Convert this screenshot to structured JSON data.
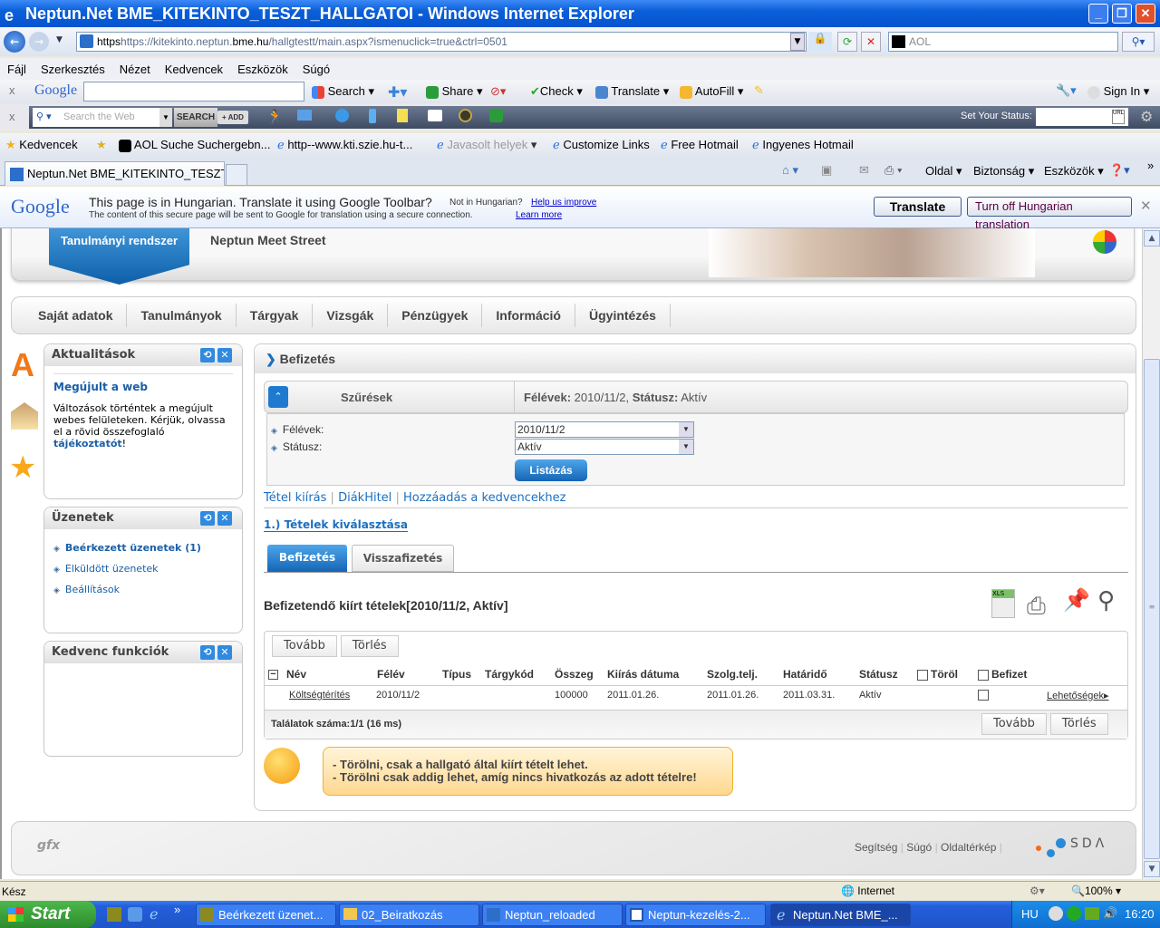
{
  "window": {
    "title": "Neptun.Net BME_KITEKINTO_TESZT_HALLGATOI - Windows Internet Explorer",
    "min": "_",
    "max": "❐",
    "close": "✕"
  },
  "address": {
    "url_prefix": "https://kitekinto.neptun.",
    "url_domain": "bme.hu",
    "url_path": "/hallgtestt/main.aspx?ismenuclick=true&ctrl=0501",
    "search_placeholder": "AOL"
  },
  "menu": [
    "Fájl",
    "Szerkesztés",
    "Nézet",
    "Kedvencek",
    "Eszközök",
    "Súgó"
  ],
  "google_toolbar": {
    "logo": "Google",
    "items": [
      "Search",
      "Share",
      "Check",
      "Translate",
      "AutoFill",
      "Sign In"
    ]
  },
  "aol_toolbar": {
    "search_placeholder": "Search the Web",
    "search_button": "SEARCH",
    "add_button": "+ ADD",
    "status_label": "Set Your Status:"
  },
  "favorites": {
    "label": "Kedvencek",
    "links": [
      "AOL Suche Suchergebn...",
      "http--www.kti.szie.hu-t...",
      "Javasolt helyek",
      "Customize Links",
      "Free Hotmail",
      "Ingyenes Hotmail"
    ]
  },
  "tabs": {
    "active": "Neptun.Net BME_KITEKINTO_TESZT_HALLGA...",
    "commands": [
      "Oldal",
      "Biztonság",
      "Eszközök"
    ]
  },
  "translate_bar": {
    "logo": "Google",
    "message": "This page is in Hungarian.  Translate it using Google Toolbar?",
    "not_lang": "Not in Hungarian?",
    "help": "Help us improve",
    "secure_note": "The content of this secure page will be sent to Google for translation using a secure connection.",
    "learn_more": "Learn more",
    "translate_btn": "Translate",
    "turn_off_btn": "Turn off Hungarian translation"
  },
  "site": {
    "system_tab": "Tanulmányi rendszer",
    "meet_street": "Neptun Meet Street",
    "nav": [
      "Saját adatok",
      "Tanulmányok",
      "Tárgyak",
      "Vizsgák",
      "Pénzügyek",
      "Információ",
      "Ügyintézés"
    ]
  },
  "news": {
    "title": "Aktualitások",
    "headline": "Megújult a web",
    "body": "Változások történtek a megújult webes felületeken. Kérjük, olvassa el a rövid összefoglaló ",
    "link": "tájékoztatót",
    "end": "!"
  },
  "messages": {
    "title": "Üzenetek",
    "items": [
      "Beérkezett üzenetek (1)",
      "Elküldött üzenetek",
      "Beállítások"
    ]
  },
  "favfunc": {
    "title": "Kedvenc funkciók"
  },
  "main": {
    "title": "Befizetés",
    "filter": {
      "title": "Szűrések",
      "summary_l1": "Félévek:",
      "summary_v1": " 2010/11/2, ",
      "summary_l2": "Státusz:",
      "summary_v2": " Aktív",
      "semester_label": "Félévek:",
      "semester_value": "2010/11/2",
      "status_label": "Státusz:",
      "status_value": "Aktív",
      "list_button": "Listázás"
    },
    "links": [
      "Tétel kiírás",
      "DiákHitel",
      "Hozzáadás a kedvencekhez"
    ],
    "step": "1.) Tételek kiválasztása",
    "subtabs": [
      "Befizetés",
      "Visszafizetés"
    ],
    "list_title": "Befizetendő kiírt tételek[2010/11/2, Aktív]",
    "btn_next": "Tovább",
    "btn_delete": "Törlés",
    "columns": [
      "Név",
      "Félév",
      "Típus",
      "Tárgykód",
      "Összeg",
      "Kiírás dátuma",
      "Szolg.telj.",
      "Határidő",
      "Státusz",
      "Töröl",
      "Befizet"
    ],
    "rows": [
      {
        "name": "Költségtérítés",
        "semester": "2010/11/2",
        "type": "",
        "code": "",
        "amount": "100000",
        "issued": "2011.01.26.",
        "service": "2011.01.26.",
        "deadline": "2011.03.31.",
        "status": "Aktív",
        "options": "Lehetőségek"
      }
    ],
    "results": "Találatok száma:1/1 (16 ms)",
    "tips": [
      "- Törölni, csak a hallgató által kiírt tételt lehet.",
      "- Törölni csak addig lehet, amíg nincs hivatkozás az adott tételre!"
    ]
  },
  "footer": {
    "links": [
      "Segítség",
      "Súgó",
      "Oldaltérkép"
    ],
    "logo": "SDA Informatika",
    "left_logo": "gfx"
  },
  "statusbar": {
    "text": "Kész",
    "zone": "Internet",
    "zoom": "100%"
  },
  "taskbar": {
    "start": "Start",
    "tasks": [
      "Beérkezett üzenet...",
      "02_Beiratkozás",
      "Neptun_reloaded",
      "Neptun-kezelés-2...",
      "Neptun.Net BME_..."
    ],
    "lang": "HU",
    "time": "16:20"
  }
}
